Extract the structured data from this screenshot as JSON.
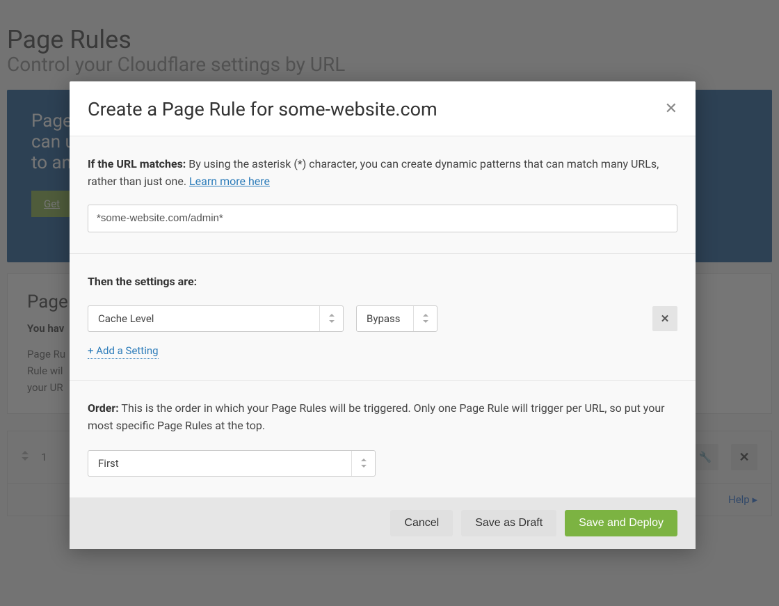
{
  "page": {
    "title": "Page Rules",
    "subtitle": "Control your Cloudflare settings by URL"
  },
  "hero": {
    "line1": "Page",
    "line2": "can u",
    "line3": "to an",
    "button": "Get"
  },
  "card": {
    "title": "Page ",
    "status_prefix": "You hav",
    "desc1": "Page Ru",
    "desc2": "Rule wil",
    "desc3": "your UR"
  },
  "row": {
    "order": "1"
  },
  "help": "Help",
  "modal": {
    "title": "Create a Page Rule for some-website.com",
    "url_label": "If the URL matches:",
    "url_desc": " By using the asterisk (*) character, you can create dynamic patterns that can match many URLs, rather than just one. ",
    "learn_more": "Learn more here",
    "url_value": "*some-website.com/admin*",
    "settings_label": "Then the settings are:",
    "setting_name": "Cache Level",
    "setting_value": "Bypass",
    "add_setting": "+ Add a Setting",
    "order_label": "Order:",
    "order_desc": " This is the order in which your Page Rules will be triggered. Only one Page Rule will trigger per URL, so put your most specific Page Rules at the top.",
    "order_value": "First",
    "cancel": "Cancel",
    "draft": "Save as Draft",
    "deploy": "Save and Deploy"
  }
}
